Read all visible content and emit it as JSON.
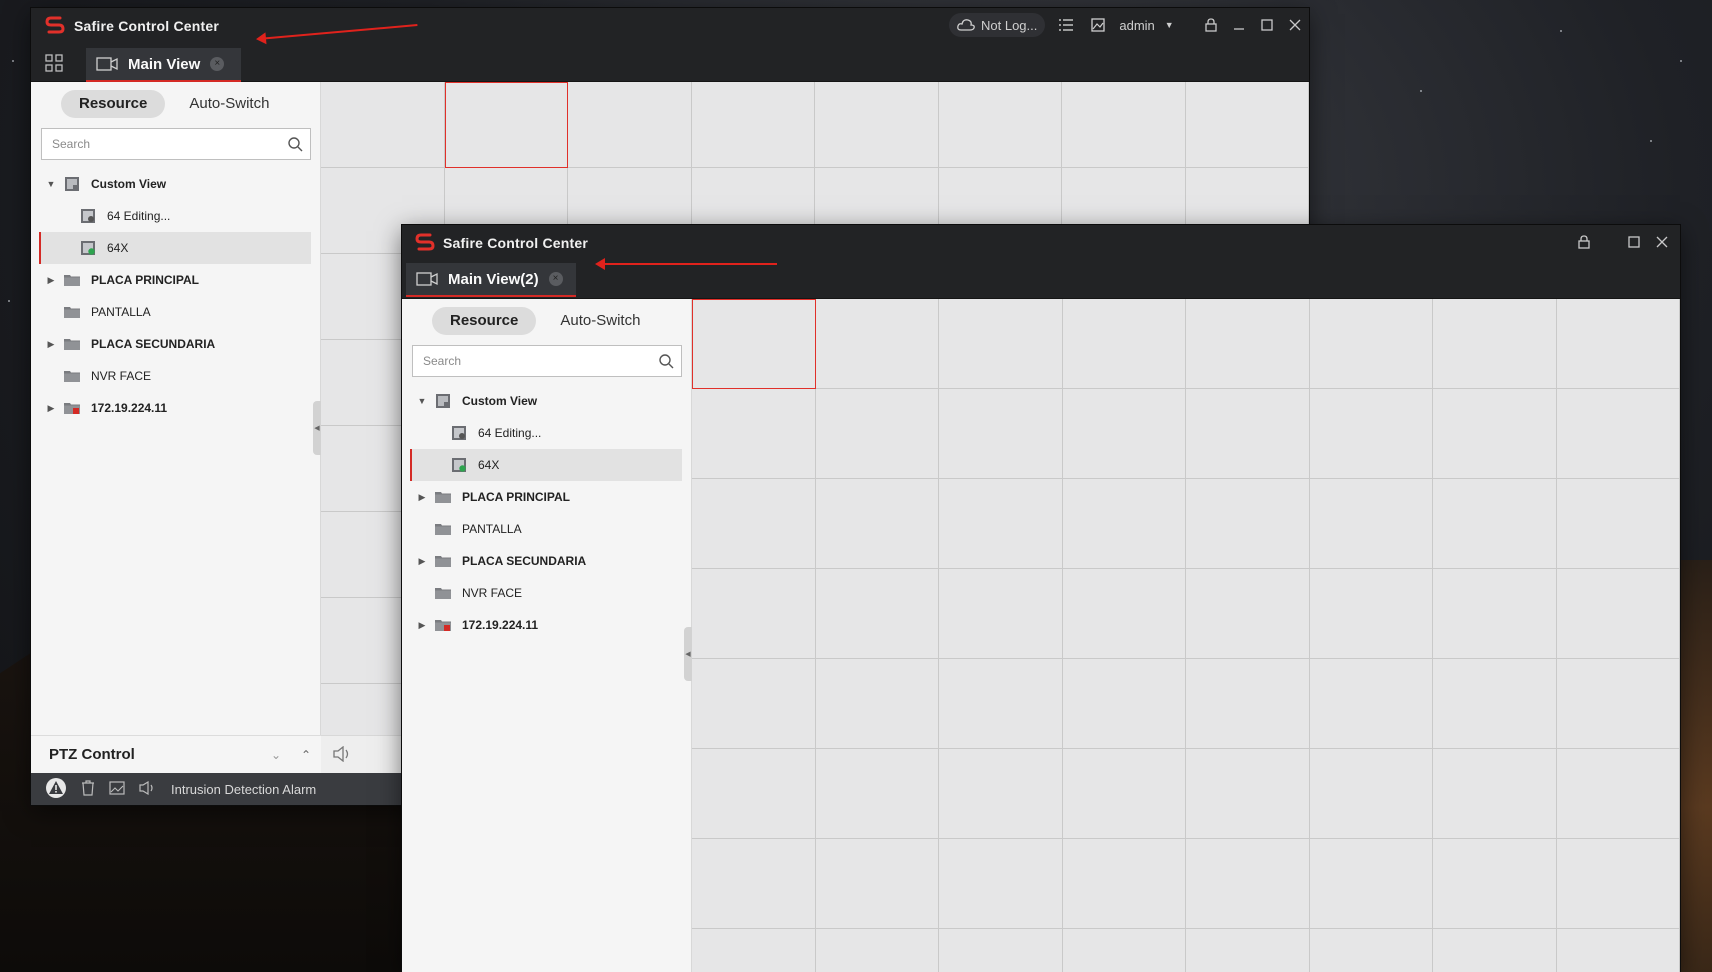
{
  "window1": {
    "app_title": "Safire Control Center",
    "tab": {
      "label": "Main View"
    },
    "cloud_status": "Not Log...",
    "user": "admin",
    "left_panel": {
      "tabs": [
        "Resource",
        "Auto-Switch"
      ],
      "search_placeholder": "Search",
      "tree": [
        {
          "label": "Custom View",
          "bold": true,
          "expand": "open",
          "icon": "custom-view-icon"
        },
        {
          "label": "64  Editing...",
          "bold": false,
          "child": true,
          "icon": "view-editing-icon"
        },
        {
          "label": "64X",
          "bold": false,
          "child": true,
          "icon": "view-live-icon",
          "selected": true
        },
        {
          "label": "PLACA PRINCIPAL",
          "bold": true,
          "expand": "closed",
          "icon": "folder-icon"
        },
        {
          "label": "PANTALLA",
          "bold": false,
          "icon": "folder-icon"
        },
        {
          "label": "PLACA SECUNDARIA",
          "bold": true,
          "expand": "closed",
          "icon": "folder-icon"
        },
        {
          "label": "NVR FACE",
          "bold": false,
          "icon": "folder-icon"
        },
        {
          "label": "172.19.224.11",
          "bold": true,
          "expand": "closed",
          "icon": "device-offline-icon"
        }
      ]
    },
    "ptz_label": "PTZ Control",
    "status_text": "Intrusion Detection Alarm"
  },
  "window2": {
    "app_title": "Safire Control Center",
    "tab": {
      "label": "Main View(2)"
    },
    "left_panel": {
      "tabs": [
        "Resource",
        "Auto-Switch"
      ],
      "search_placeholder": "Search",
      "tree": [
        {
          "label": "Custom View",
          "bold": true,
          "expand": "open",
          "icon": "custom-view-icon"
        },
        {
          "label": "64  Editing...",
          "bold": false,
          "child": true,
          "icon": "view-editing-icon"
        },
        {
          "label": "64X",
          "bold": false,
          "child": true,
          "icon": "view-live-icon",
          "selected": true
        },
        {
          "label": "PLACA PRINCIPAL",
          "bold": true,
          "expand": "closed",
          "icon": "folder-icon"
        },
        {
          "label": "PANTALLA",
          "bold": false,
          "icon": "folder-icon"
        },
        {
          "label": "PLACA SECUNDARIA",
          "bold": true,
          "expand": "closed",
          "icon": "folder-icon"
        },
        {
          "label": "NVR FACE",
          "bold": false,
          "icon": "folder-icon"
        },
        {
          "label": "172.19.224.11",
          "bold": true,
          "expand": "closed",
          "icon": "device-offline-icon"
        }
      ]
    }
  },
  "colors": {
    "accent": "#d42a25",
    "titlebar": "#222325",
    "grid_cell": "#e6e6e7",
    "annotation_arrow": "#e0221c"
  }
}
